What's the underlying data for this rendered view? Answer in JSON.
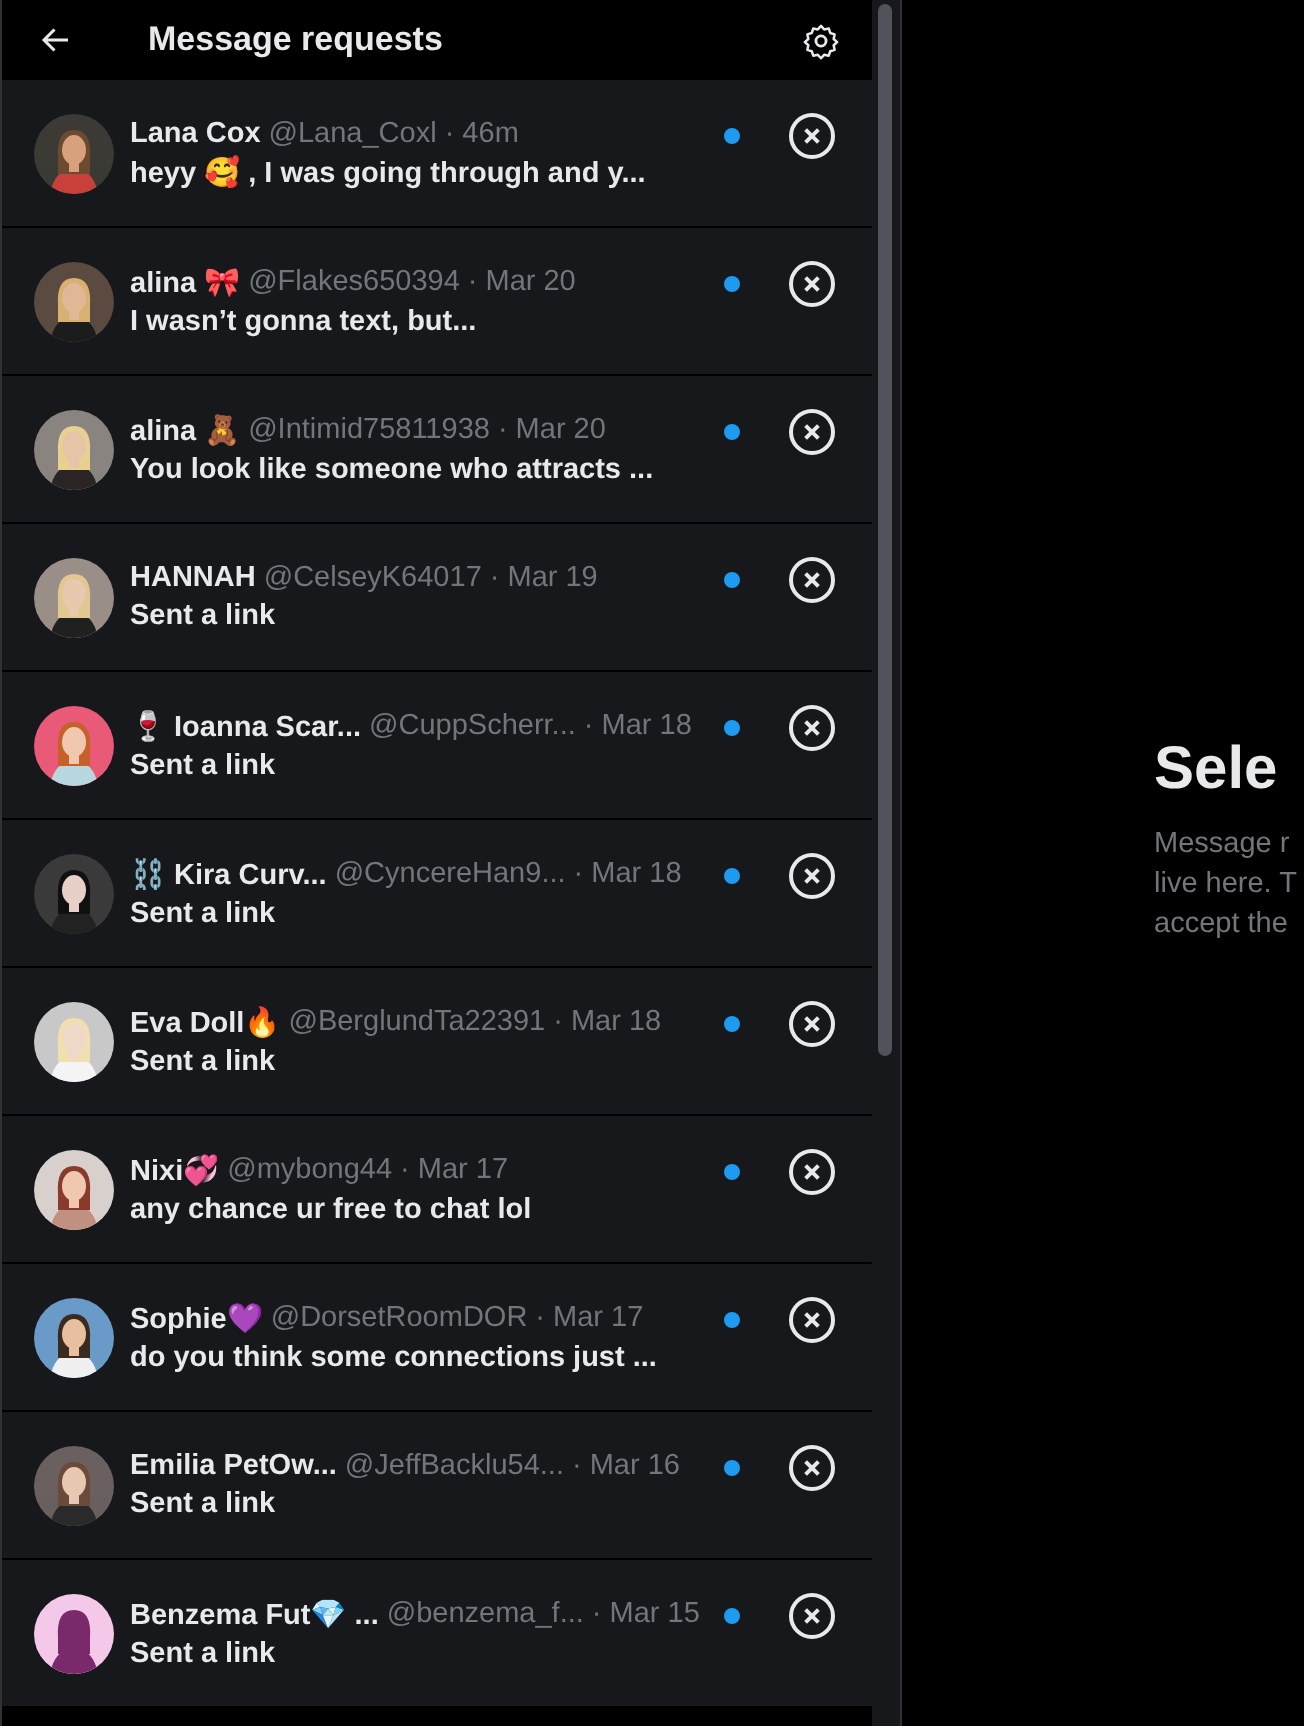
{
  "header": {
    "title": "Message requests"
  },
  "requests": [
    {
      "name": "Lana Cox",
      "handle": "@Lana_Coxl",
      "time": "· 46m",
      "preview": "heyy 🥰 , I was going through and y...",
      "unread": true
    },
    {
      "name": "alina 🎀",
      "handle": "@Flakes650394",
      "time": "· Mar 20",
      "preview": "I wasn’t gonna text, but...",
      "unread": true
    },
    {
      "name": "alina 🧸",
      "handle": "@Intimid75811938",
      "time": "· Mar 20",
      "preview": "You look like someone who attracts ...",
      "unread": true
    },
    {
      "name": "HANNAH",
      "handle": "@CelseyK64017",
      "time": "· Mar 19",
      "preview": "Sent a link",
      "unread": true
    },
    {
      "name": "🍷 Ioanna Scar...",
      "handle": "@CuppScherr...",
      "time": "· Mar 18",
      "preview": "Sent a link",
      "unread": true
    },
    {
      "name": "⛓️ Kira Curv...",
      "handle": "@CyncereHan9...",
      "time": "· Mar 18",
      "preview": "Sent a link",
      "unread": true
    },
    {
      "name": "Eva Doll🔥",
      "handle": "@BerglundTa22391",
      "time": "· Mar 18",
      "preview": "Sent a link",
      "unread": true
    },
    {
      "name": "Nixi💞",
      "handle": "@mybong44",
      "time": "· Mar 17",
      "preview": "any chance ur free to chat lol",
      "unread": true
    },
    {
      "name": "Sophie💜",
      "handle": "@DorsetRoomDOR",
      "time": "· Mar 17",
      "preview": "do you think some connections just ...",
      "unread": true
    },
    {
      "name": "Emilia PetOw...",
      "handle": "@JeffBacklu54...",
      "time": "· Mar 16",
      "preview": "Sent a link",
      "unread": true
    },
    {
      "name": "Benzema Fut💎 ...",
      "handle": "@benzema_f...",
      "time": "· Mar 15",
      "preview": "Sent a link",
      "unread": true
    }
  ],
  "empty_state": {
    "title": "Sele",
    "lines": [
      "Message r",
      "live here. T",
      "accept the"
    ]
  }
}
